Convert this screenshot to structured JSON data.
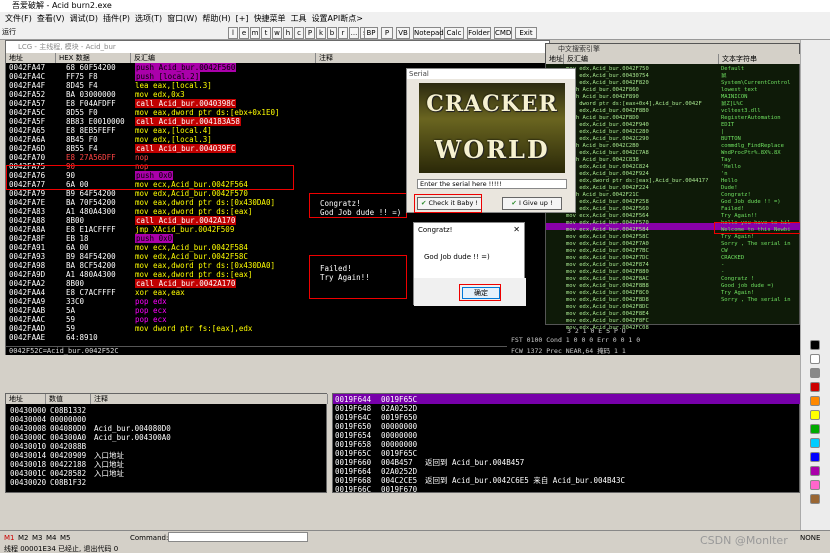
{
  "window": {
    "title": "吾爱破解 - Acid burn2.exe"
  },
  "menu": [
    "文件(F)",
    "查看(V)",
    "调试(D)",
    "插件(P)",
    "选项(T)",
    "窗口(W)",
    "帮助(H)",
    "[+]",
    "快捷菜单",
    "工具",
    "设置API断点>"
  ],
  "toolbar_letters": [
    "l",
    "e",
    "m",
    "t",
    "w",
    "h",
    "c",
    "P",
    "k",
    "b",
    "r",
    "...",
    "s"
  ],
  "toolbar_buttons": [
    "BP",
    "P",
    "VB",
    "Notepad",
    "Calc",
    "Folder",
    "CMD",
    "Exit"
  ],
  "toolbar_state": "运行",
  "cpu": {
    "title": "LCG - 主线程, 模块 - Acid_bur",
    "headers": [
      "地址",
      "HEX 数据",
      "反汇编",
      "注释"
    ],
    "rows": [
      {
        "addr": "0042FA47",
        "hex": "68 60F54200",
        "dis": "push Acid_bur.0042F560",
        "style": "push"
      },
      {
        "addr": "0042FA4C",
        "hex": "FF75 F8",
        "dis": "push [local.2]",
        "style": "push"
      },
      {
        "addr": "0042FA4F",
        "hex": "8D45 F4",
        "dis": "lea eax,[local.3]",
        "style": "y"
      },
      {
        "addr": "0042FA52",
        "hex": "BA 03000000",
        "dis": "mov edx,0x3",
        "style": "y"
      },
      {
        "addr": "0042FA57",
        "hex": "E8 F04AFDFF",
        "dis": "call Acid_bur.0040398C",
        "style": "call"
      },
      {
        "addr": "0042FA5C",
        "hex": "8D55 F0",
        "dis": "mov eax,dword ptr ds:[ebx+0x1E0]",
        "style": "y"
      },
      {
        "addr": "0042FA5F",
        "hex": "8B83 E0010000",
        "dis": "call Acid_bur.004183A58",
        "style": "call"
      },
      {
        "addr": "0042FA65",
        "hex": "E8 8EB5FEFF",
        "dis": "mov eax,[local.4]",
        "style": "y"
      },
      {
        "addr": "0042FA6A",
        "hex": "8B45 F0",
        "dis": "mov edx,[local.3]",
        "style": "y"
      },
      {
        "addr": "0042FA6D",
        "hex": "8B55 F4",
        "dis": "call Acid_bur.004039FC",
        "style": "call"
      },
      {
        "addr": "0042FA70",
        "hex": "E8 27A56DFF",
        "dis": "nop",
        "style": "nop"
      },
      {
        "addr": "0042FA75",
        "hex": "90",
        "dis": "nop",
        "style": "nop"
      },
      {
        "addr": "0042FA76",
        "hex": "90",
        "dis": "push 0x0",
        "style": "push"
      },
      {
        "addr": "0042FA77",
        "hex": "6A 00",
        "dis": "mov ecx,Acid_bur.0042F564",
        "style": "y"
      },
      {
        "addr": "0042FA79",
        "hex": "B9 64F54200",
        "dis": "mov edx,Acid_bur.0042F570",
        "style": "y"
      },
      {
        "addr": "0042FA7E",
        "hex": "BA 70F54200",
        "dis": "mov eax,dword ptr ds:[0x430DA0]",
        "style": "y"
      },
      {
        "addr": "0042FA83",
        "hex": "A1 480A4300",
        "dis": "mov eax,dword ptr ds:[eax]",
        "style": "y"
      },
      {
        "addr": "0042FA88",
        "hex": "8B00",
        "dis": "call Acid_bur.0042A170",
        "style": "call"
      },
      {
        "addr": "0042FA8A",
        "hex": "E8 E1ACFFFF",
        "dis": "jmp XAcid_bur.0042F509",
        "style": "jmp"
      },
      {
        "addr": "0042FA8F",
        "hex": "EB 18",
        "dis": "push 0x0",
        "style": "push"
      },
      {
        "addr": "0042FA91",
        "hex": "6A 00",
        "dis": "mov ecx,Acid_bur.0042F584",
        "style": "y"
      },
      {
        "addr": "0042FA93",
        "hex": "B9 84F54200",
        "dis": "mov edx,Acid_bur.0042F58C",
        "style": "y"
      },
      {
        "addr": "0042FA98",
        "hex": "BA 8CF54200",
        "dis": "mov eax,dword ptr ds:[0x430DA0]",
        "style": "y"
      },
      {
        "addr": "0042FA9D",
        "hex": "A1 480A4300",
        "dis": "mov eax,dword ptr ds:[eax]",
        "style": "y"
      },
      {
        "addr": "0042FAA2",
        "hex": "8B00",
        "dis": "call Acid_bur.0042A170",
        "style": "call"
      },
      {
        "addr": "0042FAA4",
        "hex": "E8 C7ACFFFF",
        "dis": "xor eax,eax",
        "style": "y"
      },
      {
        "addr": "0042FAA9",
        "hex": "33C0",
        "dis": "pop edx",
        "style": "m"
      },
      {
        "addr": "0042FAAB",
        "hex": "5A",
        "dis": "pop ecx",
        "style": "m"
      },
      {
        "addr": "0042FAAC",
        "hex": "59",
        "dis": "pop ecx",
        "style": "m"
      },
      {
        "addr": "0042FAAD",
        "hex": "59",
        "dis": "mov dword ptr fs:[eax],edx",
        "style": "y"
      },
      {
        "addr": "0042FAAE",
        "hex": "64:8910",
        "dis": "",
        "style": "y"
      }
    ],
    "comments": {
      "a1": "Congratz!",
      "a2": "God Job dude !! =)",
      "b1": "Failed!",
      "b2": "Try Again!!"
    },
    "info_line": "0042F52C=Acid_bur.0042F52C"
  },
  "serial": {
    "title": "Serial",
    "logo_line1": "CRACKER",
    "logo_line2": "WORLD",
    "input_value": "Enter the serial here !!!!!",
    "check_btn": "Check it Baby !",
    "give_btn": "I Give up !"
  },
  "congrats": {
    "title": "Congratz!",
    "message": "God Job dude !! =)",
    "ok": "确定",
    "close": "✕"
  },
  "strings_win": {
    "title": "中文搜索引擎",
    "headers": [
      "地址",
      "反汇编",
      "文本字符串"
    ],
    "left": [
      "mov edx,Acid_bur.0042F750",
      "mov edx,Acid_bur.00430754",
      "mov edx,Acid_bur.0042F820",
      "push Acid_bur.0042F860",
      "push Acid_bur.0042F890",
      "mov dword ptr ds:[eax+0x4],Acid_bur.0042F",
      "mov edx,Acid_bur.0042F8B0",
      "push Acid_bur.0042F8D0",
      "mov edx,Acid_bur.0042F940",
      "mov edx,Acid_bur.0042C280",
      "mov edx,Acid_bur.0042C290",
      "push Acid_bur.0042C2B0",
      "mov edx,Acid_bur.0042C7A8",
      "push Acid_bur.0042C838",
      "mov edx,Acid_bur.0042C824",
      "mov edx,Acid_bur.0042F924",
      "mov edx,dword ptr ds:[eax],Acid_bur.004417?",
      "mov edx,Acid_bur.0042F224",
      "push Acid_bur.0042F21C",
      "mov edx,Acid_bur.0042F258",
      "mov edx,Acid_bur.0042F560",
      "mov ecx,Acid_bur.0042F564",
      "mov edx,Acid_bur.0042F570",
      "mov ecx,Acid_bur.0042F584",
      "mov edx,Acid_bur.0042F58C",
      "mov edx,Acid_bur.0042F7A0",
      "mov edx,Acid_bur.0042F7BC",
      "mov edx,Acid_bur.0042F7DC",
      "mov edx,Acid_bur.0042F874",
      "mov edx,Acid_bur.0042F880",
      "mov edx,Acid_bur.0042F8AC",
      "mov edx,Acid_bur.0042F8B8",
      "mov edx,Acid_bur.0042F8C0",
      "mov edx,Acid_bur.0042F8D8",
      "mov edx,Acid_bur.0042F8DC",
      "mov edx,Acid_bur.0042F8E4",
      "mov edx,Acid_bur.0042F8FC",
      "mov edx,Acid_bur.0042FC08"
    ],
    "right": [
      "Default",
      "鼠",
      "System\\CurrentControl",
      "lowest text",
      "MAINICON",
      "鼠Z]L%C",
      "vcltest3.dll",
      "RegisterAutomation",
      "EDIT",
      "|",
      "BUTTON",
      "commdlg_FindReplace",
      "WndProcPtr%.8X%.8X",
      "Tay",
      "'Hello",
      "'n",
      "Hello",
      "Dude!",
      "Congratz!",
      "God Job dude !! =)",
      "Failed!",
      "Try Again!!",
      "hello you have to kil",
      "Welcome to this Newbi",
      "Try Again!",
      "Sorry , The serial in",
      "CW",
      "CRACKED",
      "-",
      "-",
      "Congratz !",
      "Good job dude =)",
      "Try Again!",
      "Sorry , The serial in"
    ]
  },
  "registers": {
    "flags": "3 2 1 0     E S P U",
    "fst": "FST 0100  Cond 1 0 0 0  Err 0 0 1 0",
    "fcw": "FCW 1372  Prec NEAR,64  掩码  1 1"
  },
  "dump": {
    "headers": [
      "地址",
      "数值",
      "注释"
    ],
    "rows": [
      {
        "a": "00430000",
        "v": "C08B1332",
        "c": ""
      },
      {
        "a": "00430004",
        "v": "00000000",
        "c": ""
      },
      {
        "a": "00430008",
        "v": "004080D0",
        "c": "Acid_bur.004080D0"
      },
      {
        "a": "0043000C",
        "v": "004300A0",
        "c": "Acid_bur.004300A0"
      },
      {
        "a": "00430010",
        "v": "0042088B",
        "c": ""
      },
      {
        "a": "00430014",
        "v": "00420909",
        "c": "入口地址"
      },
      {
        "a": "00430018",
        "v": "00422188",
        "c": "入口地址"
      },
      {
        "a": "0043001C",
        "v": "00428582",
        "c": "入口地址"
      },
      {
        "a": "00430020",
        "v": "C08B1F32",
        "c": ""
      }
    ]
  },
  "stack": {
    "rows": [
      {
        "a": "0019F644",
        "v": "0019F65C",
        "c": ""
      },
      {
        "a": "0019F648",
        "v": "02A0252D",
        "c": ""
      },
      {
        "a": "0019F64C",
        "v": "0019F650",
        "c": ""
      },
      {
        "a": "0019F650",
        "v": "00000000",
        "c": ""
      },
      {
        "a": "0019F654",
        "v": "00000000",
        "c": ""
      },
      {
        "a": "0019F658",
        "v": "00000000",
        "c": ""
      },
      {
        "a": "0019F65C",
        "v": "0019F65C",
        "c": ""
      },
      {
        "a": "0019F660",
        "v": "004B457",
        "c": "返回到 Acid_bur.004B457"
      },
      {
        "a": "0019F664",
        "v": "02A0252D",
        "c": ""
      },
      {
        "a": "0019F668",
        "v": "004C2CE5",
        "c": "返回到 Acid_bur.0042C6E5 来自 Acid_bur.004B43C"
      },
      {
        "a": "0019F66C",
        "v": "0019F670",
        "c": ""
      }
    ]
  },
  "status": {
    "tabs": [
      "M1",
      "M2",
      "M3",
      "M4",
      "M5"
    ],
    "command_label": "Command:",
    "text": "线程 00001E34 已经止, 退出代码 0",
    "watermark": "CSDN @Monlter",
    "none": "NONE"
  },
  "colors": {
    "cpu_bg": "#000000",
    "green": "#00ff00",
    "call_red": "#c00000",
    "push_magenta": "#aa00aa",
    "highlight": "#8800aa"
  }
}
